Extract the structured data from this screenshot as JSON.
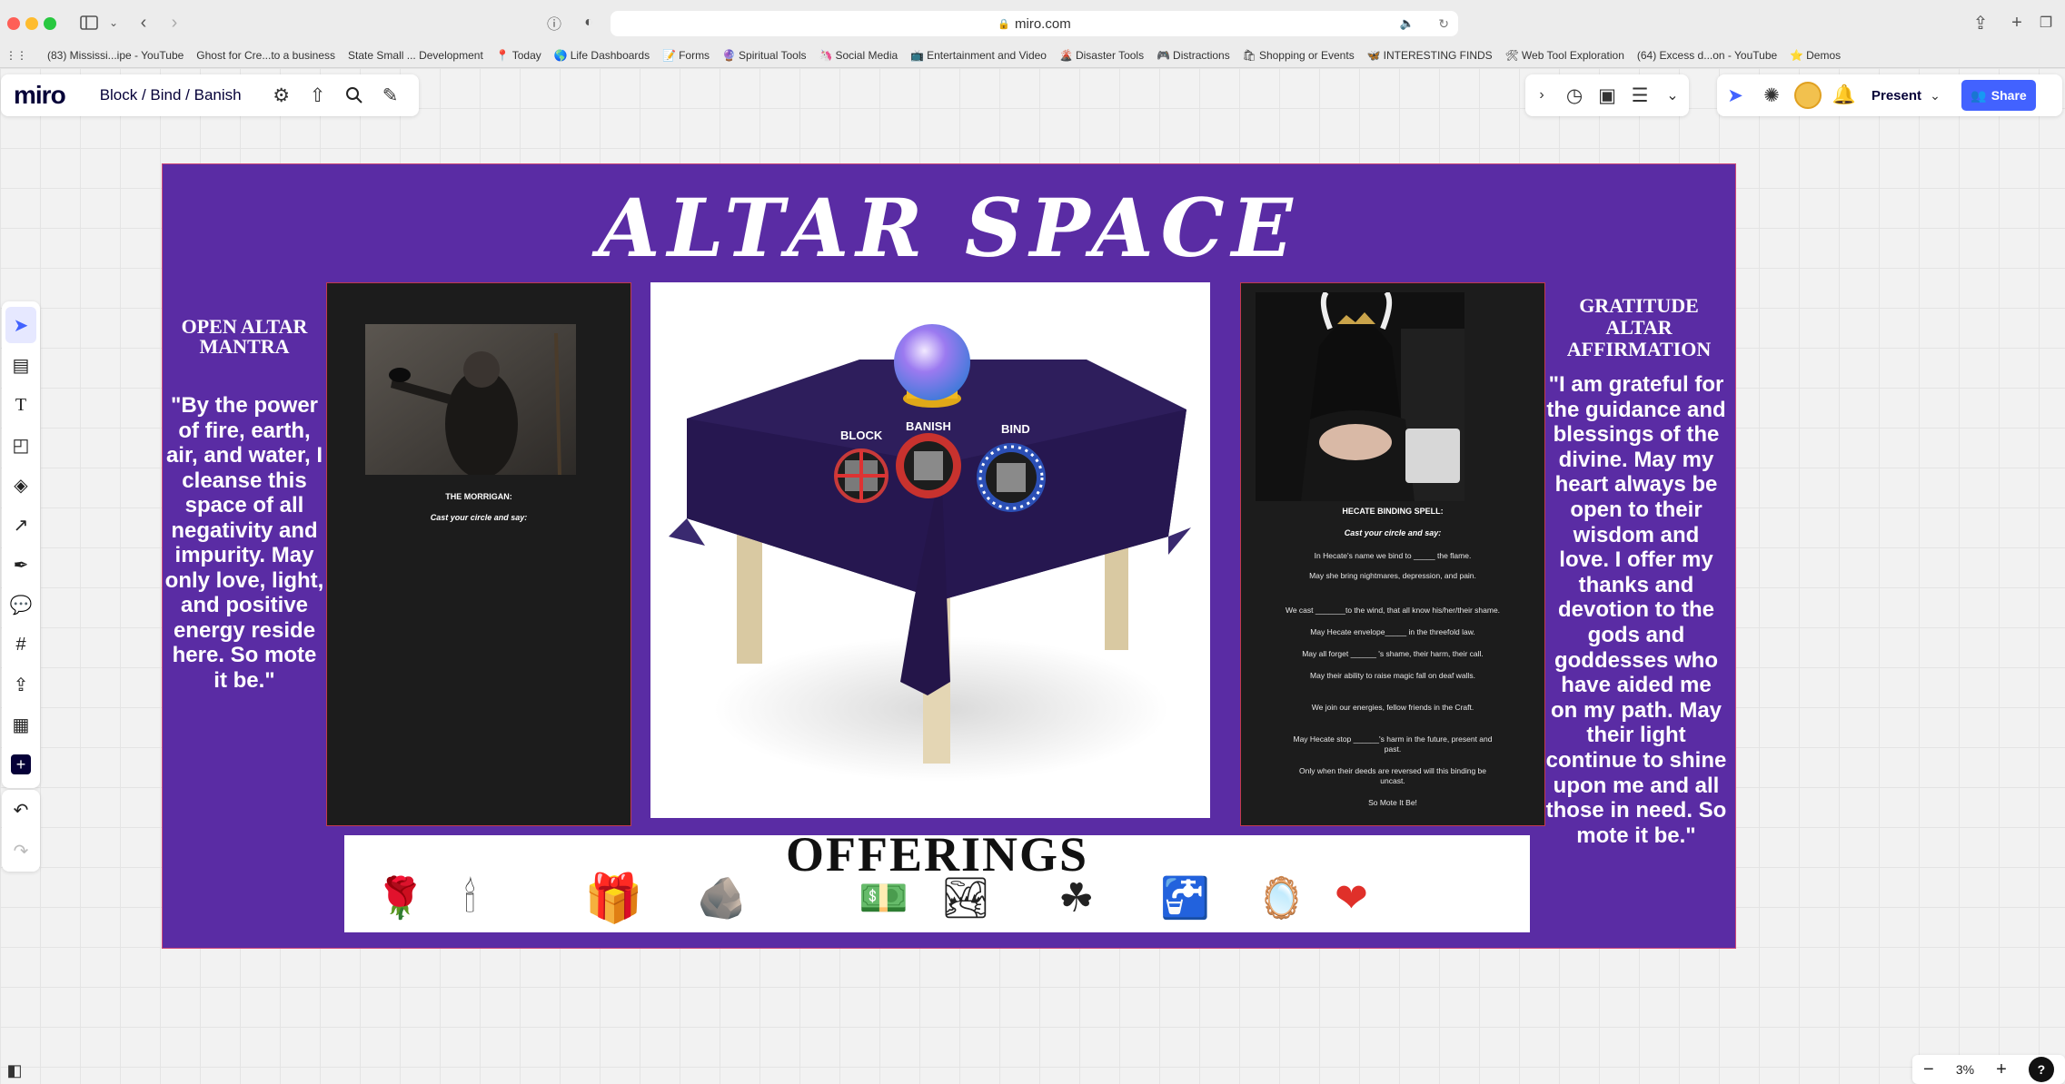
{
  "browser": {
    "url": "miro.com",
    "bookmarks": [
      {
        "icon": "",
        "label": "(83) Mississi...ipe - YouTube"
      },
      {
        "icon": "",
        "label": "Ghost for Cre...to a business"
      },
      {
        "icon": "",
        "label": "State Small ... Development"
      },
      {
        "icon": "📍",
        "label": "Today"
      },
      {
        "icon": "🌎",
        "label": "Life Dashboards"
      },
      {
        "icon": "📝",
        "label": "Forms"
      },
      {
        "icon": "🔮",
        "label": "Spiritual Tools"
      },
      {
        "icon": "🦄",
        "label": "Social Media"
      },
      {
        "icon": "📺",
        "label": "Entertainment and Video"
      },
      {
        "icon": "🌋",
        "label": "Disaster Tools"
      },
      {
        "icon": "🎮",
        "label": "Distractions"
      },
      {
        "icon": "🛍",
        "label": "Shopping or Events"
      },
      {
        "icon": "🦋",
        "label": "INTERESTING FINDS"
      },
      {
        "icon": "🛠",
        "label": "Web Tool Exploration"
      },
      {
        "icon": "",
        "label": "(64) Excess d...on - YouTube"
      },
      {
        "icon": "⭐",
        "label": "Demos"
      }
    ]
  },
  "miro": {
    "logo": "miro",
    "board_name": "Block / Bind / Banish",
    "present_label": "Present",
    "share_label": "Share",
    "zoom": "3%",
    "help": "?"
  },
  "board": {
    "title": "ALTAR SPACE",
    "left_heading": "OPEN ALTAR MANTRA",
    "left_text": "\"By the power of fire, earth, air, and water, I cleanse this space of all negativity and impurity. May only love, light, and positive energy reside here. So mote it be.\"",
    "morrigan": {
      "title": "THE MORRIGAN:",
      "subtitle": "Cast your circle and say:"
    },
    "altar_labels": {
      "block": "BLOCK",
      "banish": "BANISH",
      "bind": "BIND"
    },
    "hecate": {
      "title": "HECATE BINDING SPELL:",
      "subtitle": "Cast your circle and say:",
      "lines": [
        "In Hecate's name we bind to _____ the flame.",
        "May she bring nightmares, depression, and pain.",
        "We cast _______to the wind, that all know his/her/their shame.",
        "May Hecate envelope_____ in the threefold law.",
        "May all forget ______ 's shame, their harm, their call.",
        "May their ability to raise magic fall on deaf walls.",
        "We join our energies, fellow friends in the Craft.",
        "May Hecate stop ______'s harm in the future, present and past.",
        "Only when their deeds are reversed will this binding be uncast.",
        "So Mote It Be!"
      ]
    },
    "right_heading": "GRATITUDE ALTAR AFFIRMATION",
    "right_text": "\"I am grateful for the guidance and blessings of the divine. May my heart always be open to their wisdom and love. I offer my thanks and devotion to the gods and goddesses who have aided me on my path. May their light continue to shine upon me and all those in need. So mote it be.\"",
    "offerings_title": "OFFERINGS",
    "offerings": [
      "🌹",
      "🕯",
      "🎁",
      "🪨",
      "💵",
      "🏞",
      "☘",
      "🚰",
      "🪞",
      "❤"
    ]
  },
  "colors": {
    "board_bg": "#5a2ca4",
    "accent": "#4262ff"
  }
}
